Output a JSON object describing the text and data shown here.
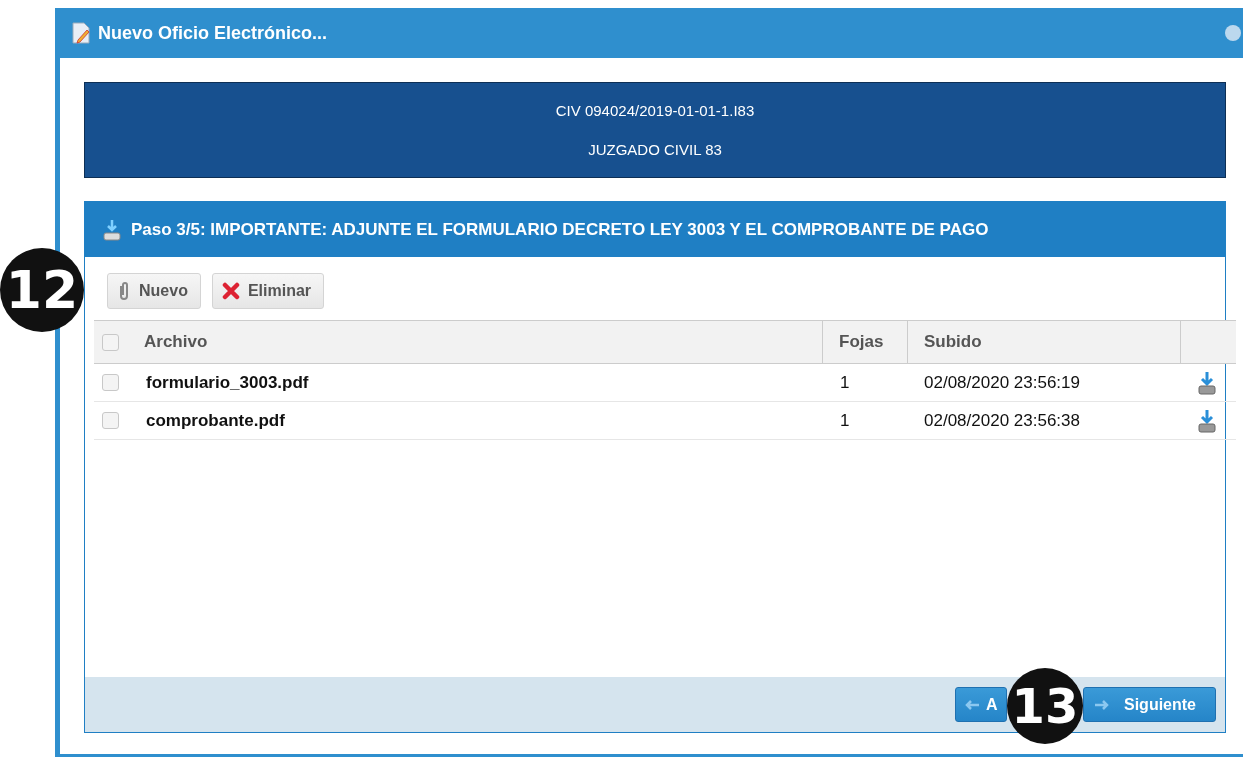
{
  "window": {
    "title": "Nuevo Oficio Electrónico..."
  },
  "case_header": {
    "lines": [
      "CIV 094024/2019-01-01-1.I83",
      "JUZGADO CIVIL 83"
    ]
  },
  "step_panel": {
    "title": "Paso 3/5: IMPORTANTE: ADJUNTE EL FORMULARIO DECRETO LEY 3003 Y EL COMPROBANTE DE PAGO",
    "toolbar": [
      {
        "kind": "attach",
        "label": "Nuevo"
      },
      {
        "kind": "delete",
        "label": "Eliminar"
      }
    ],
    "table": {
      "select_all_checked": false,
      "columns": [
        "Archivo",
        "Fojas",
        "Subido"
      ],
      "rows": [
        {
          "checked": false,
          "archivo": "formulario_3003.pdf",
          "fojas": "1",
          "subido": "02/08/2020 23:56:19"
        },
        {
          "checked": false,
          "archivo": "comprobante.pdf",
          "fojas": "1",
          "subido": "02/08/2020 23:56:38"
        }
      ]
    }
  },
  "footer": {
    "buttons": [
      {
        "kind": "back",
        "label": "A"
      },
      {
        "kind": "next",
        "label": "Siguiente"
      }
    ]
  },
  "annotations": [
    {
      "kind": "toolbar",
      "label": "12"
    },
    {
      "kind": "footer",
      "label": "13"
    }
  ]
}
